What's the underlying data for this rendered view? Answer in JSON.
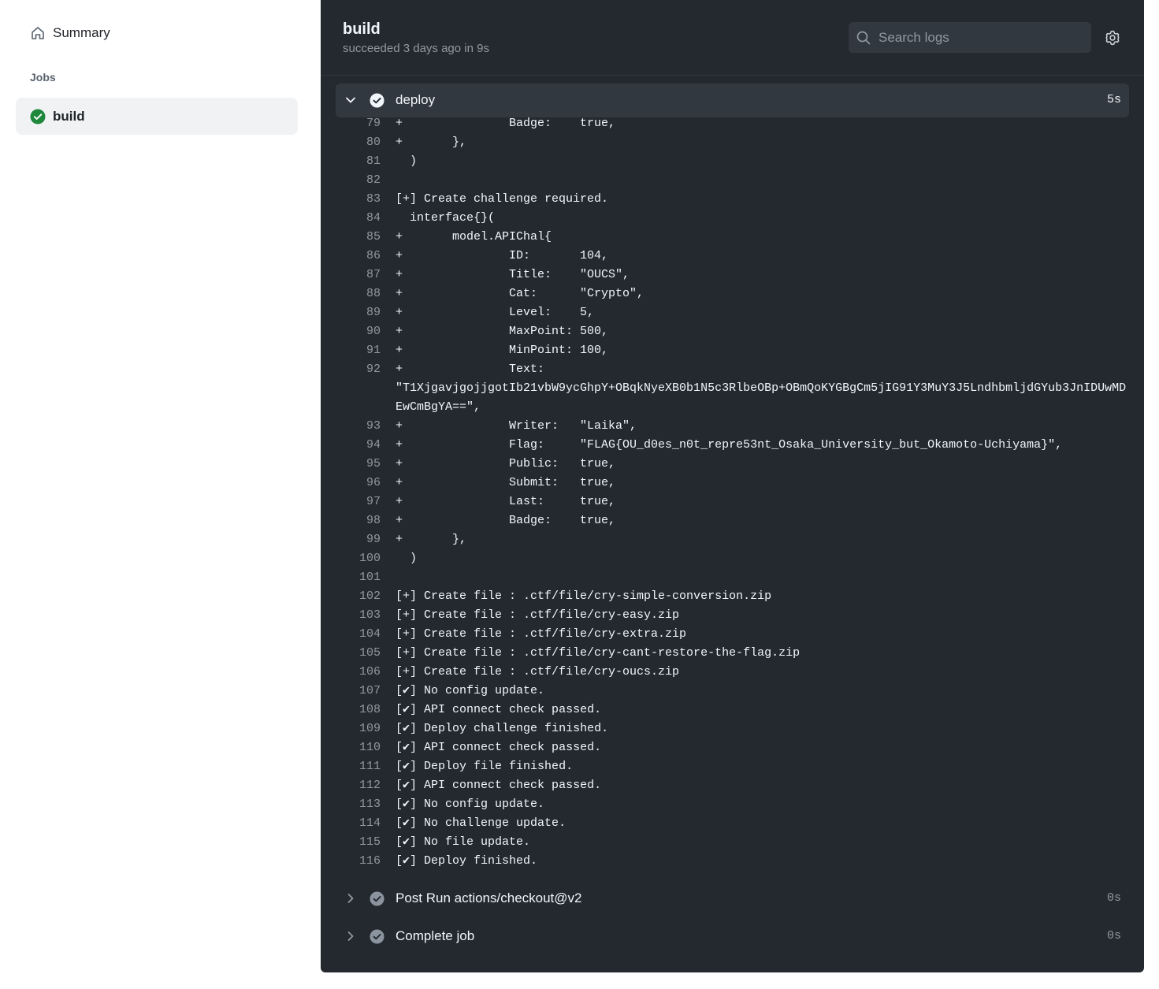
{
  "sidebar": {
    "summary_label": "Summary",
    "jobs_heading": "Jobs",
    "job_label": "build"
  },
  "header": {
    "title": "build",
    "status": "succeeded 3 days ago in 9s",
    "search_placeholder": "Search logs"
  },
  "steps": [
    {
      "name": "deploy",
      "duration": "5s",
      "state": "expanded"
    },
    {
      "name": "Post Run actions/checkout@v2",
      "duration": "0s",
      "state": "collapsed"
    },
    {
      "name": "Complete job",
      "duration": "0s",
      "state": "collapsed"
    }
  ],
  "log_lines": [
    {
      "n": "79",
      "t": "+               Badge:    true,"
    },
    {
      "n": "80",
      "t": "+       },"
    },
    {
      "n": "81",
      "t": "  )"
    },
    {
      "n": "82",
      "t": ""
    },
    {
      "n": "83",
      "t": "[+] Create challenge required."
    },
    {
      "n": "84",
      "t": "  interface{}("
    },
    {
      "n": "85",
      "t": "+       model.APIChal{"
    },
    {
      "n": "86",
      "t": "+               ID:       104,"
    },
    {
      "n": "87",
      "t": "+               Title:    \"OUCS\","
    },
    {
      "n": "88",
      "t": "+               Cat:      \"Crypto\","
    },
    {
      "n": "89",
      "t": "+               Level:    5,"
    },
    {
      "n": "90",
      "t": "+               MaxPoint: 500,"
    },
    {
      "n": "91",
      "t": "+               MinPoint: 100,"
    },
    {
      "n": "92",
      "t": "+               Text:\n\"T1XjgavjgojjgotIb21vbW9ycGhpY+OBqkNyeXB0b1N5c3RlbeOBp+OBmQoKYGBgCm5jIG91Y3MuY3J5LndhbmljdGYub3JnIDUwMDEwCmBgYA==\","
    },
    {
      "n": "93",
      "t": "+               Writer:   \"Laika\","
    },
    {
      "n": "94",
      "t": "+               Flag:     \"FLAG{OU_d0es_n0t_repre53nt_Osaka_University_but_Okamoto-Uchiyama}\","
    },
    {
      "n": "95",
      "t": "+               Public:   true,"
    },
    {
      "n": "96",
      "t": "+               Submit:   true,"
    },
    {
      "n": "97",
      "t": "+               Last:     true,"
    },
    {
      "n": "98",
      "t": "+               Badge:    true,"
    },
    {
      "n": "99",
      "t": "+       },"
    },
    {
      "n": "100",
      "t": "  )"
    },
    {
      "n": "101",
      "t": ""
    },
    {
      "n": "102",
      "t": "[+] Create file : .ctf/file/cry-simple-conversion.zip"
    },
    {
      "n": "103",
      "t": "[+] Create file : .ctf/file/cry-easy.zip"
    },
    {
      "n": "104",
      "t": "[+] Create file : .ctf/file/cry-extra.zip"
    },
    {
      "n": "105",
      "t": "[+] Create file : .ctf/file/cry-cant-restore-the-flag.zip"
    },
    {
      "n": "106",
      "t": "[+] Create file : .ctf/file/cry-oucs.zip"
    },
    {
      "n": "107",
      "t": "[✔] No config update."
    },
    {
      "n": "108",
      "t": "[✔] API connect check passed."
    },
    {
      "n": "109",
      "t": "[✔] Deploy challenge finished."
    },
    {
      "n": "110",
      "t": "[✔] API connect check passed."
    },
    {
      "n": "111",
      "t": "[✔] Deploy file finished."
    },
    {
      "n": "112",
      "t": "[✔] API connect check passed."
    },
    {
      "n": "113",
      "t": "[✔] No config update."
    },
    {
      "n": "114",
      "t": "[✔] No challenge update."
    },
    {
      "n": "115",
      "t": "[✔] No file update."
    },
    {
      "n": "116",
      "t": "[✔] Deploy finished."
    }
  ],
  "colors": {
    "success": "#1f883d",
    "panel_bg": "#24292f",
    "step_check_gray": "#8b949e"
  }
}
